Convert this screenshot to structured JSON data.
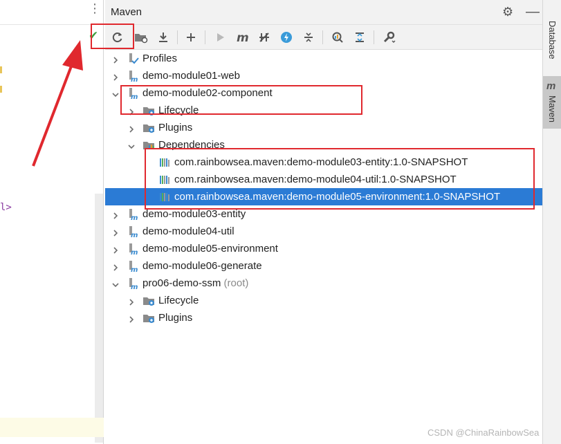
{
  "maven_panel": {
    "title": "Maven"
  },
  "toolbar": {
    "buttons": [
      {
        "name": "reload-all-projects-button",
        "icon": "reload-icon"
      },
      {
        "name": "generate-sources-button",
        "icon": "folder-reload-icon"
      },
      {
        "name": "download-sources-button",
        "icon": "download-icon"
      },
      {
        "name": "add-maven-project-button",
        "icon": "plus-icon"
      },
      {
        "name": "run-maven-build-button",
        "icon": "run-icon"
      },
      {
        "name": "execute-goal-button",
        "icon": "maven-m-icon"
      },
      {
        "name": "toggle-offline-button",
        "icon": "offline-icon"
      },
      {
        "name": "skip-tests-button",
        "icon": "lightning-icon"
      },
      {
        "name": "collapse-all-button",
        "icon": "collapse-icon"
      },
      {
        "name": "show-dependencies-button",
        "icon": "analyze-icon"
      },
      {
        "name": "expand-all-button",
        "icon": "expand-icon"
      },
      {
        "name": "settings-button",
        "icon": "wrench-icon"
      }
    ]
  },
  "tree": [
    {
      "label": "Profiles",
      "suffix": "",
      "depth": 0,
      "expanded": false,
      "icon": "profiles",
      "selected": false
    },
    {
      "label": "demo-module01-web",
      "suffix": "",
      "depth": 0,
      "expanded": false,
      "icon": "module",
      "selected": false
    },
    {
      "label": "demo-module02-component",
      "suffix": "",
      "depth": 0,
      "expanded": true,
      "icon": "module",
      "selected": false
    },
    {
      "label": "Lifecycle",
      "suffix": "",
      "depth": 1,
      "expanded": false,
      "icon": "lifecycle",
      "selected": false
    },
    {
      "label": "Plugins",
      "suffix": "",
      "depth": 1,
      "expanded": false,
      "icon": "plugins",
      "selected": false
    },
    {
      "label": "Dependencies",
      "suffix": "",
      "depth": 1,
      "expanded": true,
      "icon": "dependencies",
      "selected": false
    },
    {
      "label": "com.rainbowsea.maven:demo-module03-entity:1.0-SNAPSHOT",
      "suffix": "",
      "depth": 2,
      "expanded": null,
      "icon": "library",
      "selected": false
    },
    {
      "label": "com.rainbowsea.maven:demo-module04-util:1.0-SNAPSHOT",
      "suffix": "",
      "depth": 2,
      "expanded": null,
      "icon": "library",
      "selected": false
    },
    {
      "label": "com.rainbowsea.maven:demo-module05-environment:1.0-SNAPSHOT",
      "suffix": "",
      "depth": 2,
      "expanded": null,
      "icon": "library",
      "selected": true
    },
    {
      "label": "demo-module03-entity",
      "suffix": "",
      "depth": 0,
      "expanded": false,
      "icon": "module",
      "selected": false
    },
    {
      "label": "demo-module04-util",
      "suffix": "",
      "depth": 0,
      "expanded": false,
      "icon": "module",
      "selected": false
    },
    {
      "label": "demo-module05-environment",
      "suffix": "",
      "depth": 0,
      "expanded": false,
      "icon": "module",
      "selected": false
    },
    {
      "label": "demo-module06-generate",
      "suffix": "",
      "depth": 0,
      "expanded": false,
      "icon": "module",
      "selected": false
    },
    {
      "label": "pro06-demo-ssm",
      "suffix": "(root)",
      "depth": 0,
      "expanded": true,
      "icon": "module",
      "selected": false
    },
    {
      "label": "Lifecycle",
      "suffix": "",
      "depth": 1,
      "expanded": false,
      "icon": "lifecycle",
      "selected": false
    },
    {
      "label": "Plugins",
      "suffix": "",
      "depth": 1,
      "expanded": false,
      "icon": "plugins",
      "selected": false
    }
  ],
  "right_strip": {
    "database_tab": "Database",
    "maven_tab": "Maven"
  },
  "editor": {
    "fragment_text": "l>"
  },
  "watermark": "CSDN @ChinaRainbowSea",
  "colors": {
    "selection": "#2b7bd5",
    "annotation_red": "#e0282e",
    "toolbar_bg": "#f2f2f2"
  }
}
